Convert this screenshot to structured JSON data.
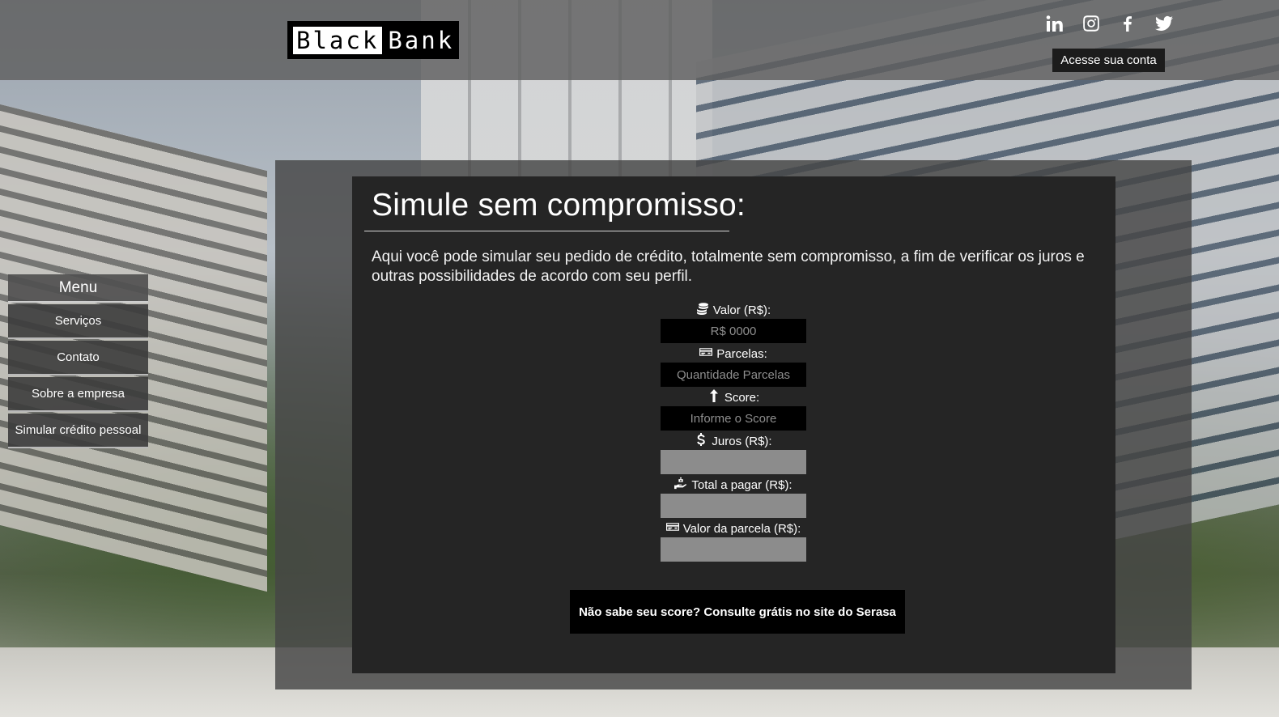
{
  "header": {
    "logo_black": "Black",
    "logo_bank": "Bank",
    "social_icons": [
      "linkedin-icon",
      "instagram-icon",
      "facebook-icon",
      "twitter-icon"
    ],
    "account_button": "Acesse sua conta"
  },
  "menu": {
    "title": "Menu",
    "items": [
      {
        "label": "Serviços"
      },
      {
        "label": "Contato"
      },
      {
        "label": "Sobre a empresa"
      },
      {
        "label": "Simular crédito pessoal"
      }
    ]
  },
  "main": {
    "title": "Simule sem compromisso:",
    "intro": "Aqui você pode simular seu pedido de crédito, totalmente sem compromisso, a fim de verificar os juros e outras possibilidades de acordo com seu perfil.",
    "fields": [
      {
        "icon": "coins-icon",
        "label": "Valor (R$):",
        "placeholder": "R$ 0000",
        "value": ""
      },
      {
        "icon": "credit-card-icon",
        "label": "Parcelas:",
        "placeholder": "Quantidade Parcelas",
        "value": ""
      },
      {
        "icon": "arrow-up-icon",
        "label": "Score:",
        "placeholder": "Informe o Score",
        "value": ""
      },
      {
        "icon": "dollar-icon",
        "label": "Juros (R$):",
        "placeholder": "",
        "value": ""
      },
      {
        "icon": "hand-holding-money-icon",
        "label": "Total a pagar (R$):",
        "placeholder": "",
        "value": ""
      },
      {
        "icon": "credit-card-icon",
        "label": "Valor da parcela (R$):",
        "placeholder": "",
        "value": ""
      }
    ],
    "serasa_button": "Não sabe seu score? Consulte grátis no site do Serasa"
  },
  "colors": {
    "header_bg": "#5f5f5f",
    "panel_bg": "#252525",
    "input_dark": "#000000",
    "input_grey": "#8c8c8c",
    "button_bg": "#000000"
  }
}
